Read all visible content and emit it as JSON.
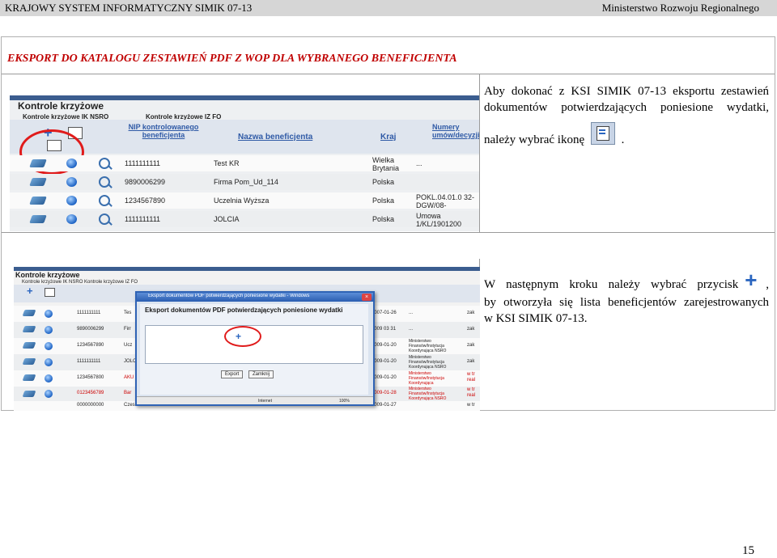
{
  "header": {
    "left": "KRAJOWY SYSTEM INFORMATYCZNY SIMIK 07-13",
    "right": "Ministerstwo Rozwoju Regionalnego"
  },
  "section_title": "EKSPORT DO KATALOGU ZESTAWIEŃ PDF Z WOP DLA WYBRANEGO BENEFICJENTA",
  "para1": {
    "line1": "Aby dokonać z KSI SIMIK 07-13 eksportu zestawień",
    "line2": "dokumentów potwierdzających poniesione wydatki,",
    "line3_pre": "należy wybrać ikonę",
    "line3_post": "."
  },
  "para2": {
    "line1_pre": "W następnym kroku należy wybrać przycisk",
    "line1_post": ",",
    "line2": "by otworzyła się lista beneficjentów zarejestrowanych",
    "line3": "w KSI SIMIK 07-13."
  },
  "shot1": {
    "title": "Kontrole krzyżowe",
    "tab1": "Kontrole krzyżowe IK NSRO",
    "tab2": "Kontrole krzyżowe IZ FO",
    "col_nip": "NIP kontrolowanego beneficjenta",
    "col_name": "Nazwa beneficjenta",
    "col_country": "Kraj",
    "col_num": "Numery umów/decyzji",
    "rows": [
      {
        "nip": "1111111111",
        "name": "Test KR",
        "country": "Wielka Brytania",
        "num": "..."
      },
      {
        "nip": "9890006299",
        "name": "Firma Pom_Ud_114",
        "country": "Polska",
        "num": ""
      },
      {
        "nip": "1234567890",
        "name": "Uczelnia Wyższa",
        "country": "Polska",
        "num": "POKL.04.01.0 32-DGW/08-"
      },
      {
        "nip": "1111111111",
        "name": "JOLCIA",
        "country": "Polska",
        "num": "Umowa 1/KL/1901200"
      }
    ]
  },
  "shot2": {
    "title": "Kontrole krzyżowe",
    "tabs": "Kontrole krzyżowe IK NSRO   Kontrole krzyżowe IZ FO",
    "window_title": "Eksport dokumentów PDF potwierdzających poniesione wydatki - Windows",
    "dialog_heading": "Eksport dokumentów PDF potwierdzających poniesione wydatki",
    "btn_export": "Export",
    "btn_close": "Zamknij",
    "status_left": "Internet",
    "status_right": "100%",
    "rows": [
      {
        "nip": "1111111111",
        "name": "Tes",
        "date": "2007-01-26",
        "inst": "...",
        "st": "zak"
      },
      {
        "nip": "9890006299",
        "name": "Firr",
        "date": "2009 03 31",
        "inst": "...",
        "st": "zak"
      },
      {
        "nip": "1234567890",
        "name": "Ucz",
        "date": "2009-01-20",
        "inst": "Ministerstwo Finansów/Instytucja Koordynująca NSRO",
        "st": "zak"
      },
      {
        "nip": "1111111111",
        "name": "JOLC",
        "date": "2009-01-20",
        "inst": "Ministerstwo Finansów/Instytucja Koordynująca NSRO",
        "st": "zak"
      },
      {
        "nip": "1234567800",
        "name": "AKU",
        "date": "2009-01-20",
        "inst": "Ministerstwo Finansów/Instytucja Koordynująca",
        "st": "w tr real"
      },
      {
        "nip": "0123456789",
        "name": "Bar",
        "date": "2009-01-28",
        "inst": "Ministerstwo Finansów/Instytucja Koordynująca NSRO",
        "st": "w tr real"
      },
      {
        "nip": "0000000000",
        "name": "Czesanie",
        "date": "2009-01-27",
        "inst": "...",
        "st": "w tr"
      }
    ]
  },
  "page_number": "15"
}
